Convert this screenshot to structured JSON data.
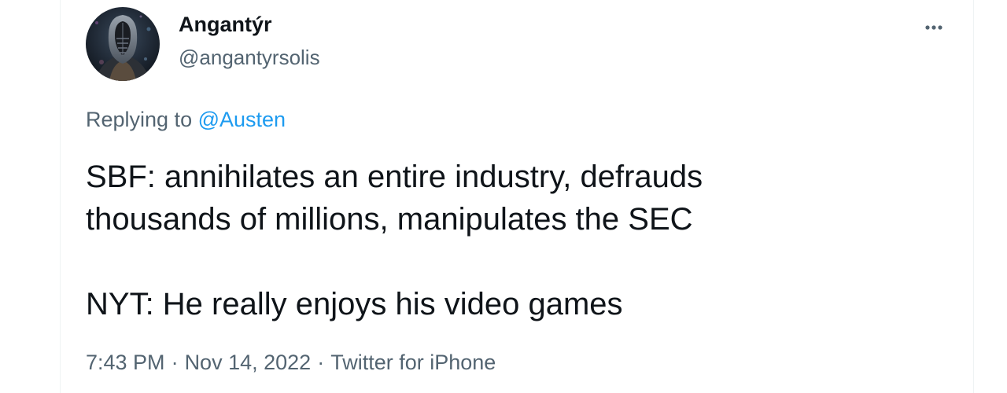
{
  "author": {
    "display_name": "Angantýr",
    "handle": "@angantyrsolis",
    "avatar_icon": "hooded-figure-avatar"
  },
  "more_menu": {
    "icon": "more-horizontal-icon"
  },
  "reply_context": {
    "prefix": "Replying to",
    "mention": "@Austen"
  },
  "tweet": {
    "lines": [
      "SBF: annihilates an entire industry, defrauds",
      "thousands of millions, manipulates the SEC",
      "NYT: He really enjoys his video games"
    ]
  },
  "meta": {
    "time": "7:43 PM",
    "separator": "·",
    "date": "Nov 14, 2022",
    "source": "Twitter for iPhone"
  },
  "colors": {
    "text_primary": "#0f1419",
    "text_secondary": "#536471",
    "accent": "#1d9bf0",
    "border": "#eff3f4"
  }
}
